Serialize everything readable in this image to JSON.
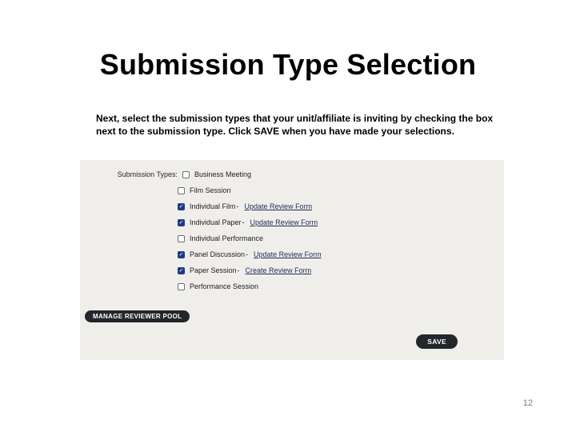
{
  "title": "Submission Type Selection",
  "instructions": "Next, select the submission types that your unit/affiliate is inviting by checking the box next to the submission type. Click SAVE when you have made your selections.",
  "form": {
    "heading": "Submission Types:",
    "items": [
      {
        "label": "Business Meeting",
        "checked": false,
        "link": ""
      },
      {
        "label": "Film Session",
        "checked": false,
        "link": ""
      },
      {
        "label": "Individual Film",
        "checked": true,
        "link": "Update Review Form"
      },
      {
        "label": "Individual Paper",
        "checked": true,
        "link": "Update Review Form"
      },
      {
        "label": "Individual Performance",
        "checked": false,
        "link": ""
      },
      {
        "label": "Panel Discussion",
        "checked": true,
        "link": "Update Review Form"
      },
      {
        "label": "Paper Session",
        "checked": true,
        "link": "Create Review Form"
      },
      {
        "label": "Performance Session",
        "checked": false,
        "link": ""
      }
    ],
    "manage_label": "MANAGE REVIEWER POOL",
    "save_label": "SAVE"
  },
  "page_number": "12"
}
